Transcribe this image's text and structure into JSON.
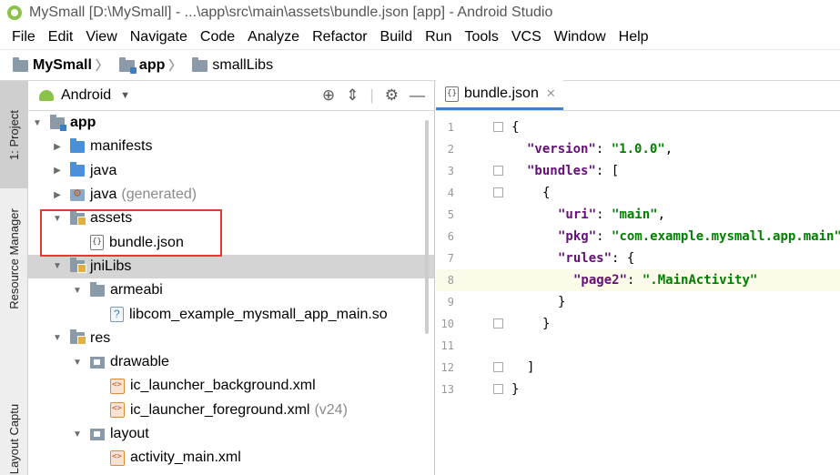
{
  "window": {
    "title": "MySmall [D:\\MySmall] - ...\\app\\src\\main\\assets\\bundle.json [app] - Android Studio"
  },
  "menu": [
    "File",
    "Edit",
    "View",
    "Navigate",
    "Code",
    "Analyze",
    "Refactor",
    "Build",
    "Run",
    "Tools",
    "VCS",
    "Window",
    "Help"
  ],
  "breadcrumb": [
    "MySmall",
    "app",
    "smallLibs"
  ],
  "side_tabs": {
    "project": "1: Project",
    "resource_manager": "Resource Manager",
    "captures": "Layout Captures"
  },
  "project_panel": {
    "view_mode": "Android",
    "tree": [
      {
        "label": "app",
        "depth": 0,
        "expanded": true,
        "icon": "module-folder-icon",
        "bold": true
      },
      {
        "label": "manifests",
        "depth": 1,
        "expanded": false,
        "icon": "blue-folder-icon"
      },
      {
        "label": "java",
        "depth": 1,
        "expanded": false,
        "icon": "blue-folder-icon"
      },
      {
        "label": "java",
        "suffix": "(generated)",
        "depth": 1,
        "expanded": false,
        "icon": "generated-folder-icon"
      },
      {
        "label": "assets",
        "depth": 1,
        "expanded": true,
        "icon": "assets-folder-icon"
      },
      {
        "label": "bundle.json",
        "depth": 2,
        "leaf": true,
        "icon": "json-file-icon"
      },
      {
        "label": "jniLibs",
        "depth": 1,
        "expanded": true,
        "icon": "jnilibs-folder-icon",
        "selected": true
      },
      {
        "label": "armeabi",
        "depth": 2,
        "expanded": true,
        "icon": "folder-icon"
      },
      {
        "label": "libcom_example_mysmall_app_main.so",
        "depth": 3,
        "leaf": true,
        "icon": "unknown-file-icon"
      },
      {
        "label": "res",
        "depth": 1,
        "expanded": true,
        "icon": "res-folder-icon"
      },
      {
        "label": "drawable",
        "depth": 2,
        "expanded": true,
        "icon": "small-folder-icon"
      },
      {
        "label": "ic_launcher_background.xml",
        "depth": 3,
        "leaf": true,
        "icon": "xml-file-icon"
      },
      {
        "label": "ic_launcher_foreground.xml",
        "suffix": "(v24)",
        "depth": 3,
        "leaf": true,
        "icon": "xml-file-icon"
      },
      {
        "label": "layout",
        "depth": 2,
        "expanded": true,
        "icon": "small-folder-icon"
      },
      {
        "label": "activity_main.xml",
        "depth": 3,
        "leaf": true,
        "icon": "xml-file-icon"
      }
    ]
  },
  "editor": {
    "tab": "bundle.json",
    "current_line": 8,
    "lines": [
      {
        "n": "1",
        "indent": 0,
        "parts": [
          [
            "p",
            "{"
          ]
        ]
      },
      {
        "n": "2",
        "indent": 1,
        "parts": [
          [
            "k",
            "\"version\""
          ],
          [
            "p",
            ": "
          ],
          [
            "s",
            "\"1.0.0\""
          ],
          [
            "p",
            ","
          ]
        ]
      },
      {
        "n": "3",
        "indent": 1,
        "parts": [
          [
            "k",
            "\"bundles\""
          ],
          [
            "p",
            ": ["
          ]
        ]
      },
      {
        "n": "4",
        "indent": 2,
        "parts": [
          [
            "p",
            "{"
          ]
        ]
      },
      {
        "n": "5",
        "indent": 3,
        "parts": [
          [
            "k",
            "\"uri\""
          ],
          [
            "p",
            ": "
          ],
          [
            "s",
            "\"main\""
          ],
          [
            "p",
            ","
          ]
        ]
      },
      {
        "n": "6",
        "indent": 3,
        "parts": [
          [
            "k",
            "\"pkg\""
          ],
          [
            "p",
            ": "
          ],
          [
            "s",
            "\"com.example.mysmall.app.main\""
          ],
          [
            "p",
            ","
          ]
        ]
      },
      {
        "n": "7",
        "indent": 3,
        "parts": [
          [
            "k",
            "\"rules\""
          ],
          [
            "p",
            ": {"
          ]
        ]
      },
      {
        "n": "8",
        "indent": 4,
        "parts": [
          [
            "k",
            "\"page2\""
          ],
          [
            "p",
            ": "
          ],
          [
            "s",
            "\".MainActivity\""
          ]
        ]
      },
      {
        "n": "9",
        "indent": 3,
        "parts": [
          [
            "p",
            "}"
          ]
        ]
      },
      {
        "n": "10",
        "indent": 2,
        "parts": [
          [
            "p",
            "}"
          ]
        ]
      },
      {
        "n": "11",
        "indent": 0,
        "parts": []
      },
      {
        "n": "12",
        "indent": 1,
        "parts": [
          [
            "p",
            "]"
          ]
        ]
      },
      {
        "n": "13",
        "indent": 0,
        "parts": [
          [
            "p",
            "}"
          ]
        ]
      }
    ]
  },
  "colors": {
    "keyword": "#660e7a",
    "string": "#008000",
    "highlight_box": "#e53935",
    "tab_underline": "#4083c9",
    "current_line_bg": "#fcfae8"
  }
}
